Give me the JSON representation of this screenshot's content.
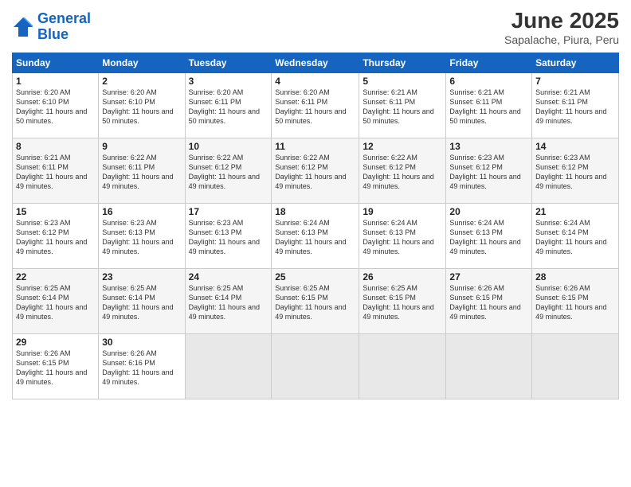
{
  "header": {
    "logo_line1": "General",
    "logo_line2": "Blue",
    "title": "June 2025",
    "subtitle": "Sapalache, Piura, Peru"
  },
  "columns": [
    "Sunday",
    "Monday",
    "Tuesday",
    "Wednesday",
    "Thursday",
    "Friday",
    "Saturday"
  ],
  "weeks": [
    [
      {
        "day": "1",
        "rise": "6:20 AM",
        "set": "6:10 PM",
        "daylight": "11 hours and 50 minutes."
      },
      {
        "day": "2",
        "rise": "6:20 AM",
        "set": "6:10 PM",
        "daylight": "11 hours and 50 minutes."
      },
      {
        "day": "3",
        "rise": "6:20 AM",
        "set": "6:11 PM",
        "daylight": "11 hours and 50 minutes."
      },
      {
        "day": "4",
        "rise": "6:20 AM",
        "set": "6:11 PM",
        "daylight": "11 hours and 50 minutes."
      },
      {
        "day": "5",
        "rise": "6:21 AM",
        "set": "6:11 PM",
        "daylight": "11 hours and 50 minutes."
      },
      {
        "day": "6",
        "rise": "6:21 AM",
        "set": "6:11 PM",
        "daylight": "11 hours and 50 minutes."
      },
      {
        "day": "7",
        "rise": "6:21 AM",
        "set": "6:11 PM",
        "daylight": "11 hours and 49 minutes."
      }
    ],
    [
      {
        "day": "8",
        "rise": "6:21 AM",
        "set": "6:11 PM",
        "daylight": "11 hours and 49 minutes."
      },
      {
        "day": "9",
        "rise": "6:22 AM",
        "set": "6:11 PM",
        "daylight": "11 hours and 49 minutes."
      },
      {
        "day": "10",
        "rise": "6:22 AM",
        "set": "6:12 PM",
        "daylight": "11 hours and 49 minutes."
      },
      {
        "day": "11",
        "rise": "6:22 AM",
        "set": "6:12 PM",
        "daylight": "11 hours and 49 minutes."
      },
      {
        "day": "12",
        "rise": "6:22 AM",
        "set": "6:12 PM",
        "daylight": "11 hours and 49 minutes."
      },
      {
        "day": "13",
        "rise": "6:23 AM",
        "set": "6:12 PM",
        "daylight": "11 hours and 49 minutes."
      },
      {
        "day": "14",
        "rise": "6:23 AM",
        "set": "6:12 PM",
        "daylight": "11 hours and 49 minutes."
      }
    ],
    [
      {
        "day": "15",
        "rise": "6:23 AM",
        "set": "6:12 PM",
        "daylight": "11 hours and 49 minutes."
      },
      {
        "day": "16",
        "rise": "6:23 AM",
        "set": "6:13 PM",
        "daylight": "11 hours and 49 minutes."
      },
      {
        "day": "17",
        "rise": "6:23 AM",
        "set": "6:13 PM",
        "daylight": "11 hours and 49 minutes."
      },
      {
        "day": "18",
        "rise": "6:24 AM",
        "set": "6:13 PM",
        "daylight": "11 hours and 49 minutes."
      },
      {
        "day": "19",
        "rise": "6:24 AM",
        "set": "6:13 PM",
        "daylight": "11 hours and 49 minutes."
      },
      {
        "day": "20",
        "rise": "6:24 AM",
        "set": "6:13 PM",
        "daylight": "11 hours and 49 minutes."
      },
      {
        "day": "21",
        "rise": "6:24 AM",
        "set": "6:14 PM",
        "daylight": "11 hours and 49 minutes."
      }
    ],
    [
      {
        "day": "22",
        "rise": "6:25 AM",
        "set": "6:14 PM",
        "daylight": "11 hours and 49 minutes."
      },
      {
        "day": "23",
        "rise": "6:25 AM",
        "set": "6:14 PM",
        "daylight": "11 hours and 49 minutes."
      },
      {
        "day": "24",
        "rise": "6:25 AM",
        "set": "6:14 PM",
        "daylight": "11 hours and 49 minutes."
      },
      {
        "day": "25",
        "rise": "6:25 AM",
        "set": "6:15 PM",
        "daylight": "11 hours and 49 minutes."
      },
      {
        "day": "26",
        "rise": "6:25 AM",
        "set": "6:15 PM",
        "daylight": "11 hours and 49 minutes."
      },
      {
        "day": "27",
        "rise": "6:26 AM",
        "set": "6:15 PM",
        "daylight": "11 hours and 49 minutes."
      },
      {
        "day": "28",
        "rise": "6:26 AM",
        "set": "6:15 PM",
        "daylight": "11 hours and 49 minutes."
      }
    ],
    [
      {
        "day": "29",
        "rise": "6:26 AM",
        "set": "6:15 PM",
        "daylight": "11 hours and 49 minutes."
      },
      {
        "day": "30",
        "rise": "6:26 AM",
        "set": "6:16 PM",
        "daylight": "11 hours and 49 minutes."
      },
      null,
      null,
      null,
      null,
      null
    ]
  ]
}
